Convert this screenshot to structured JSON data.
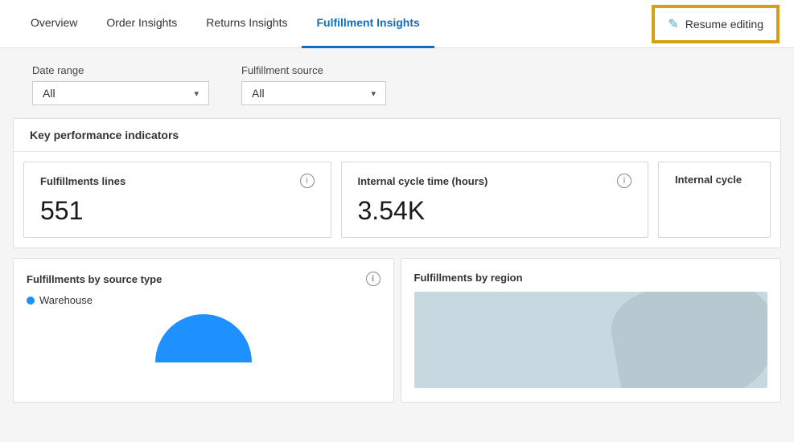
{
  "nav": {
    "tabs": [
      {
        "id": "overview",
        "label": "Overview",
        "active": false
      },
      {
        "id": "order-insights",
        "label": "Order Insights",
        "active": false
      },
      {
        "id": "returns-insights",
        "label": "Returns Insights",
        "active": false
      },
      {
        "id": "fulfillment-insights",
        "label": "Fulfillment Insights",
        "active": true
      }
    ],
    "resume_editing_label": "Resume editing"
  },
  "filters": {
    "date_range_label": "Date range",
    "date_range_value": "All",
    "fulfillment_source_label": "Fulfillment source",
    "fulfillment_source_value": "All"
  },
  "kpi": {
    "section_title": "Key performance indicators",
    "cards": [
      {
        "title": "Fulfillments lines",
        "value": "551"
      },
      {
        "title": "Internal cycle time (hours)",
        "value": "3.54K"
      },
      {
        "title": "Internal cycle",
        "value": ""
      }
    ]
  },
  "charts": {
    "fulfillments_by_source": {
      "title": "Fulfillments by source type",
      "legend": [
        {
          "label": "Warehouse",
          "color": "#1e90ff"
        }
      ]
    },
    "fulfillments_by_region": {
      "title": "Fulfillments by region"
    }
  },
  "icons": {
    "chevron_down": "▾",
    "info": "i",
    "pencil": "✎"
  }
}
